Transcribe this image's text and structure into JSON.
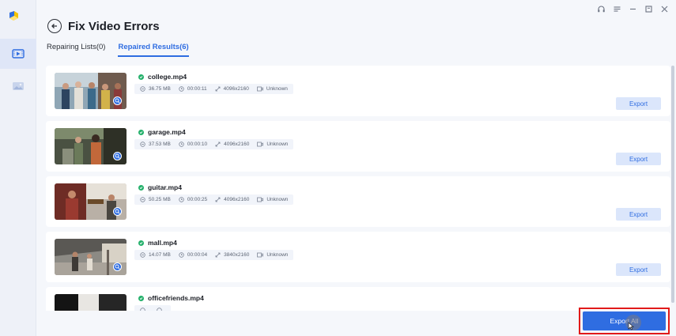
{
  "app": {
    "title": "Fix Video Errors",
    "colors": {
      "accent": "#2f6de1",
      "success": "#23b06a",
      "highlight": "#e11a1a"
    }
  },
  "sidebar": {
    "items": [
      {
        "icon": "logo-icon",
        "active": false
      },
      {
        "icon": "video-repair-icon",
        "active": true
      },
      {
        "icon": "photo-repair-icon",
        "active": false
      }
    ]
  },
  "window_controls": [
    "headset-icon",
    "menu-icon",
    "minimize-icon",
    "maximize-icon",
    "close-icon"
  ],
  "tabs": [
    {
      "label": "Repairing Lists(0)",
      "active": false
    },
    {
      "label": "Repaired Results(6)",
      "active": true
    }
  ],
  "files": [
    {
      "name": "college.mp4",
      "size": "36.75 MB",
      "duration": "00:00:11",
      "resolution": "4096x2160",
      "format": "Unknown",
      "export_label": "Export"
    },
    {
      "name": "garage.mp4",
      "size": "37.53 MB",
      "duration": "00:00:10",
      "resolution": "4096x2160",
      "format": "Unknown",
      "export_label": "Export"
    },
    {
      "name": "guitar.mp4",
      "size": "50.25 MB",
      "duration": "00:00:25",
      "resolution": "4096x2160",
      "format": "Unknown",
      "export_label": "Export"
    },
    {
      "name": "mall.mp4",
      "size": "14.07 MB",
      "duration": "00:00:04",
      "resolution": "3840x2160",
      "format": "Unknown",
      "export_label": "Export"
    },
    {
      "name": "officefriends.mp4",
      "size": "",
      "duration": "",
      "resolution": "",
      "format": "",
      "export_label": ""
    }
  ],
  "footer": {
    "export_all_label": "Export All"
  }
}
